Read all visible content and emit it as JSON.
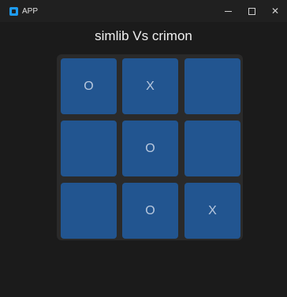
{
  "window": {
    "app_title": "APP",
    "minimize_glyph": "",
    "close_glyph": "✕"
  },
  "game": {
    "title": "simlib Vs crimon",
    "board": [
      [
        "O",
        "X",
        ""
      ],
      [
        "",
        "O",
        ""
      ],
      [
        "",
        "O",
        "X"
      ]
    ]
  },
  "colors": {
    "cell": "#225590",
    "background": "#1b1b1b",
    "board": "#2a2a2a"
  }
}
